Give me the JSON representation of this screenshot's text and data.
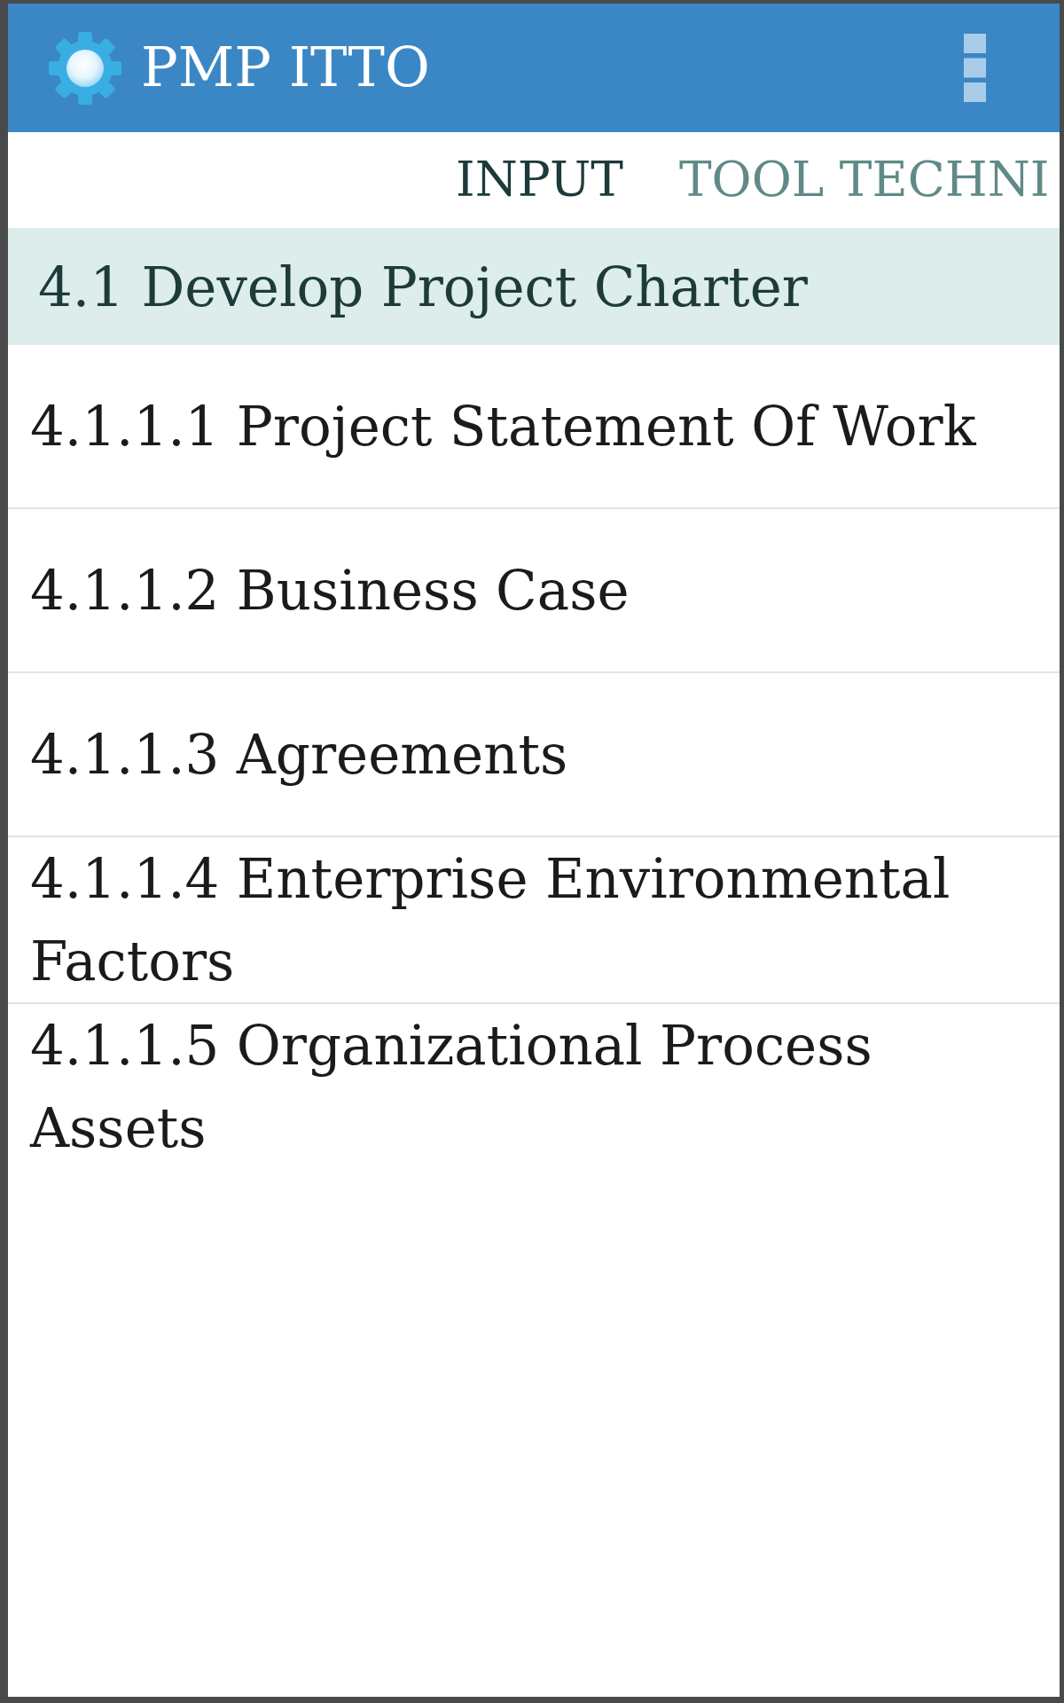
{
  "app_bar": {
    "title": "PMP ITTO"
  },
  "tabs": [
    {
      "label": "INPUT",
      "selected": true
    },
    {
      "label": "TOOL TECHNI",
      "selected": false
    }
  ],
  "section": {
    "title": "4.1 Develop Project Charter"
  },
  "items": [
    "4.1.1.1 Project Statement Of Work",
    "4.1.1.2 Business Case",
    "4.1.1.3 Agreements",
    "4.1.1.4 Enterprise Environmental Factors",
    "4.1.1.5 Organizational Process Assets"
  ]
}
